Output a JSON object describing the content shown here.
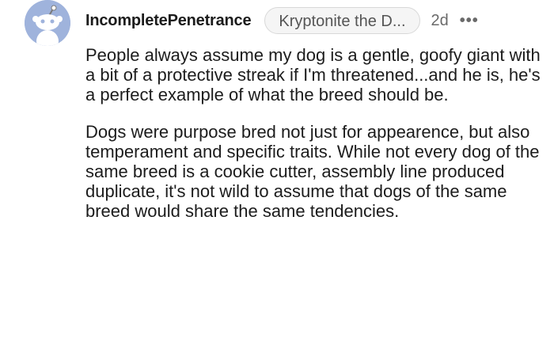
{
  "comment": {
    "username": "IncompletePenetrance",
    "flair": "Kryptonite the D...",
    "time": "2d",
    "more_icon": "ellipsis-icon",
    "avatar_icon": "snoo-avatar-icon",
    "avatar_color": "#9fb3dc",
    "paragraphs": [
      "People always assume my dog is a gentle, goofy giant with a bit of a protective streak if I'm threatened...and he is, he's a perfect example of what the breed should be.",
      "Dogs were purpose bred not just for appearence, but also temperament and specific traits. While not every dog of the same breed is a cookie cutter, assembly line produced duplicate, it's not wild to assume that dogs of the same breed would share the same tendencies."
    ]
  }
}
